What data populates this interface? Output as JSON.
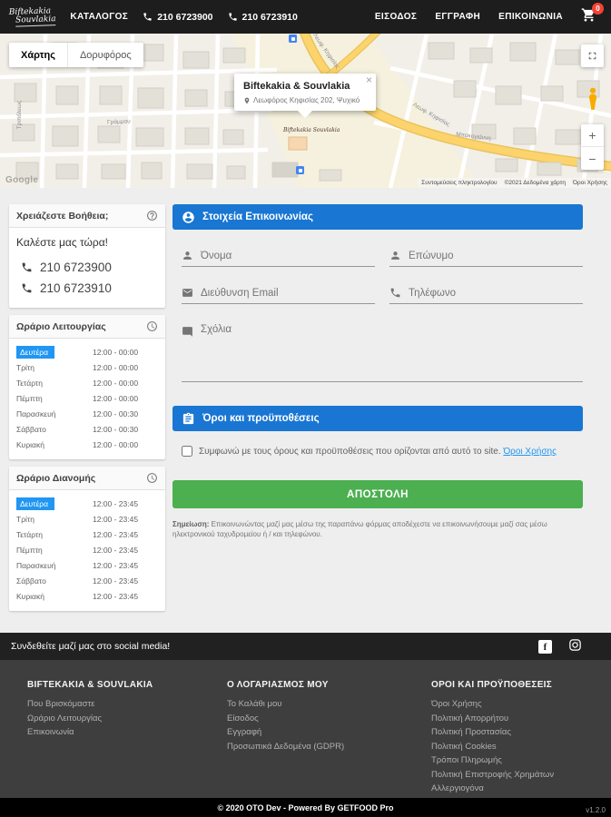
{
  "navbar": {
    "logo": {
      "line1": "Biftekakia",
      "line2": "Souvlakia"
    },
    "items": {
      "catalog": "ΚΑΤΑΛΟΓΟΣ",
      "login": "ΕΙΣΟΔΟΣ",
      "register": "ΕΓΓΡΑΦΗ",
      "contact": "ΕΠΙΚΟΙΝΩΝΙΑ"
    },
    "phone1": "210 6723900",
    "phone2": "210 6723910",
    "cart_count": "0"
  },
  "map": {
    "buttons": {
      "map": "Χάρτης",
      "satellite": "Δορυφόρος"
    },
    "info": {
      "title": "Biftekakia & Souvlakia",
      "address": "Λεωφόρος Κηφισίας 202, Ψυχικό",
      "close": "×"
    },
    "marker_label": "Biftekakia Souvlakia",
    "streets": {
      "s1": "Λεωφ. Κηφισίας",
      "s2": "Λεωφ. Κηφισίας",
      "s3": "Τριπόλεως",
      "s4": "Γράμμου",
      "s5": "Μπακογιάννη"
    },
    "zoom_in": "+",
    "zoom_out": "−",
    "google": "Google",
    "attribution": {
      "shortcuts": "Συντομεύσεις πληκτρολογίου",
      "data": "©2021 Δεδομένα χάρτη",
      "terms": "Όροι Χρήσης"
    }
  },
  "sidebar": {
    "help": {
      "title": "Χρειάζεστε Βοήθεια;",
      "subtitle": "Καλέστε μας τώρα!",
      "phone1": "210 6723900",
      "phone2": "210 6723910"
    },
    "hours": {
      "title": "Ωράριο Λειτουργίας",
      "rows": [
        {
          "day": "Δευτέρα",
          "time": "12:00 - 00:00",
          "active": true
        },
        {
          "day": "Τρίτη",
          "time": "12:00 - 00:00"
        },
        {
          "day": "Τετάρτη",
          "time": "12:00 - 00:00"
        },
        {
          "day": "Πέμπτη",
          "time": "12:00 - 00:00"
        },
        {
          "day": "Παρασκευή",
          "time": "12:00 - 00:30"
        },
        {
          "day": "Σάββατο",
          "time": "12:00 - 00:30"
        },
        {
          "day": "Κυριακή",
          "time": "12:00 - 00:00"
        }
      ]
    },
    "delivery": {
      "title": "Ωράριο Διανομής",
      "rows": [
        {
          "day": "Δευτέρα",
          "time": "12:00 - 23:45",
          "active": true
        },
        {
          "day": "Τρίτη",
          "time": "12:00 - 23:45"
        },
        {
          "day": "Τετάρτη",
          "time": "12:00 - 23:45"
        },
        {
          "day": "Πέμπτη",
          "time": "12:00 - 23:45"
        },
        {
          "day": "Παρασκευή",
          "time": "12:00 - 23:45"
        },
        {
          "day": "Σάββατο",
          "time": "12:00 - 23:45"
        },
        {
          "day": "Κυριακή",
          "time": "12:00 - 23:45"
        }
      ]
    }
  },
  "form": {
    "header": "Στοιχεία Επικοινωνίας",
    "placeholders": {
      "first_name": "Όνομα",
      "last_name": "Επώνυμο",
      "email": "Διεύθυνση Email",
      "phone": "Τηλέφωνο",
      "comments": "Σχόλια"
    },
    "terms_header": "Όροι και προϋποθέσεις",
    "terms_text": "Συμφωνώ με τους όρους και προϋποθέσεις που ορίζονται από αυτό το site.",
    "terms_link": "Όροι Χρήσης",
    "submit": "ΑΠΟΣΤΟΛΗ",
    "note_label": "Σημείωση:",
    "note_text": "Επικοινωνώντας μαζί μας μέσω της παραπάνω φόρμας αποδέχεστε να επικοινωνήσουμε μαζί σας μέσω ηλεκτρονικού ταχυδρομείου ή / και τηλεφώνου."
  },
  "footer": {
    "social_text": "Συνδεθείτε μαζί μας στο social media!",
    "columns": [
      {
        "heading": "BIFTEKAKIA & SOUVLAKIA",
        "links": [
          "Που Βρισκόμαστε",
          "Ωράριο Λειτουργίας",
          "Επικοινωνία"
        ]
      },
      {
        "heading": "Ο ΛΟΓΑΡΙΑΣΜΟΣ ΜΟΥ",
        "links": [
          "Το Καλάθι μου",
          "Είσοδος",
          "Εγγραφή",
          "Προσωπικά Δεδομένα (GDPR)"
        ]
      },
      {
        "heading": "ΟΡΟΙ ΚΑΙ ΠΡΟΫΠΟΘΕΣΕΙΣ",
        "links": [
          "Όροι Χρήσης",
          "Πολιτική Απορρήτου",
          "Πολιτική Προστασίας",
          "Πολιτική Cookies",
          "Τρόποι Πληρωμής",
          "Πολιτική Επιστροφής Χρημάτων",
          "Αλλεργιογόνα"
        ]
      }
    ],
    "copyright": "© 2020 OTO Dev - Powered By GETFOOD Pro",
    "version": "v1.2.0"
  },
  "colors": {
    "accent_blue": "#1976d2",
    "active_day": "#2196f3",
    "success_green": "#4caf50",
    "badge_red": "#f44336"
  }
}
